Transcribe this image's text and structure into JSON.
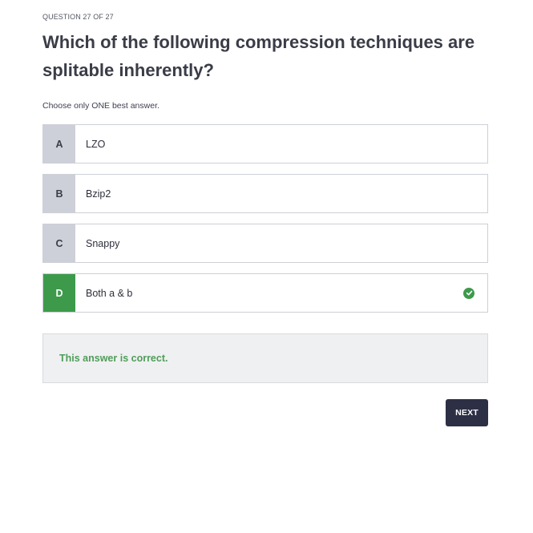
{
  "header": {
    "counter": "QUESTION 27 OF 27"
  },
  "question": {
    "title": "Which of the following compression techniques are splitable inherently?",
    "instruction": "Choose only ONE best answer."
  },
  "options": [
    {
      "letter": "A",
      "text": "LZO",
      "selected": false
    },
    {
      "letter": "B",
      "text": "Bzip2",
      "selected": false
    },
    {
      "letter": "C",
      "text": "Snappy",
      "selected": false
    },
    {
      "letter": "D",
      "text": "Both a & b",
      "selected": true,
      "icon": "check-circle-icon"
    }
  ],
  "feedback": {
    "message": "This answer is correct."
  },
  "actions": {
    "next_label": "NEXT"
  },
  "colors": {
    "correct": "#3d9a4b",
    "letter_bg": "#cdd0d8",
    "button_bg": "#2d2f45"
  }
}
